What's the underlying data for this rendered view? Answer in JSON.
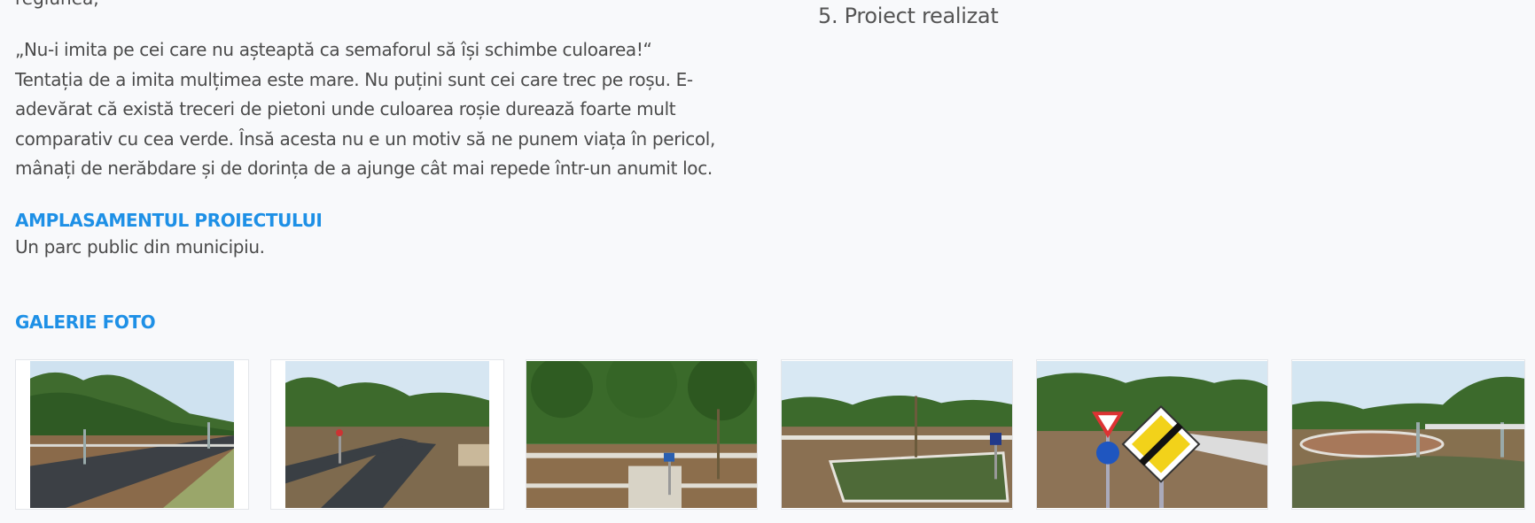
{
  "top_fragment": "regiunea,",
  "intro": {
    "lines": [
      "„Nu-i imita pe cei care nu așteaptă ca semaforul să își schimbe culoarea!“",
      "Tentația de a imita mulțimea este mare. Nu puțini sunt cei care trec pe roșu. E-",
      "adevărat că există treceri de pietoni unde culoarea roșie durează foarte mult",
      "comparativ cu cea verde. Însă acesta nu e un motiv să ne punem viața în pericol,",
      "mânați de nerăbdare și de dorința de a ajunge cât mai repede într-un anumit loc."
    ]
  },
  "location": {
    "heading": "AMPLASAMENTUL PROIECTULUI",
    "text": "Un parc public din municipiu."
  },
  "gallery": {
    "heading": "GALERIE FOTO",
    "photos": [
      {
        "label": "park-path-photo-1"
      },
      {
        "label": "park-path-photo-2"
      },
      {
        "label": "park-crossing-photo"
      },
      {
        "label": "park-flowerbeds-photo"
      },
      {
        "label": "traffic-signs-photo"
      },
      {
        "label": "park-roundabout-photo"
      }
    ]
  },
  "right_column": {
    "title": "5. Proiect realizat"
  },
  "colors": {
    "accent": "#1e90e6",
    "text": "#4b4b4b",
    "background": "#f8f9fb"
  }
}
